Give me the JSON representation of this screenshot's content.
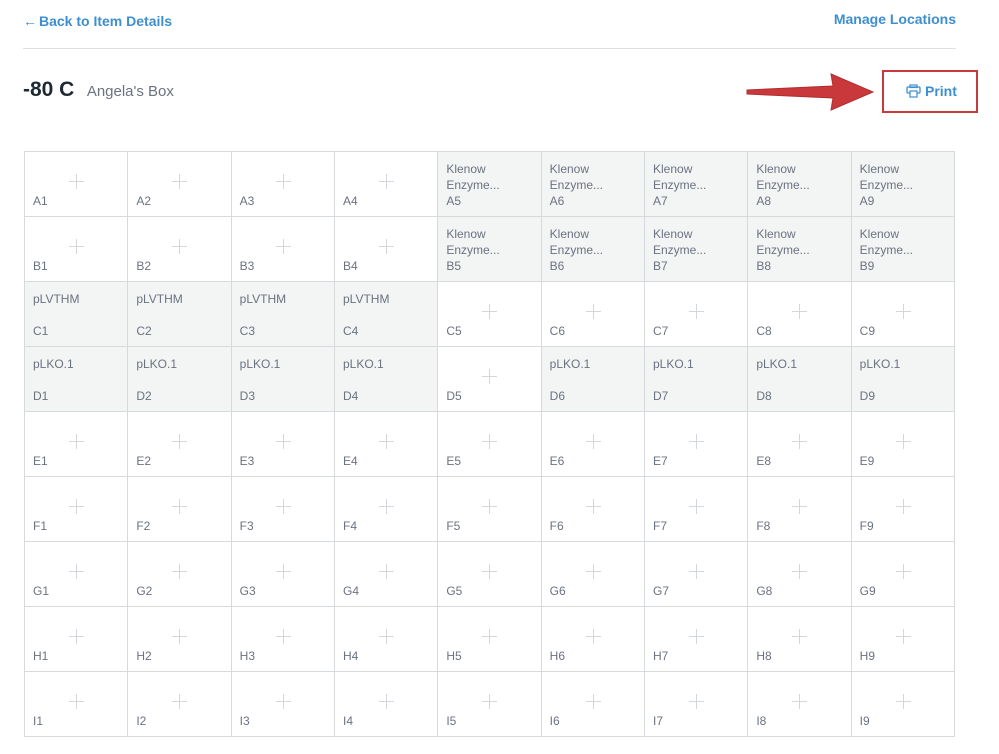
{
  "nav": {
    "back_arrow": "←",
    "back_label": "Back to Item Details",
    "manage_label": "Manage Locations"
  },
  "box": {
    "temperature": "-80 C",
    "name": "Angela's Box"
  },
  "print": {
    "label": "Print",
    "icon": "printer-icon",
    "highlight_color": "#c9383a"
  },
  "colors": {
    "link": "#3d8fd1",
    "filled_cell": "#f3f4f4",
    "annotation": "#c9383a"
  },
  "grid": {
    "rows": [
      "A",
      "B",
      "C",
      "D",
      "E",
      "F",
      "G",
      "H",
      "I"
    ],
    "columns": 9,
    "cells": [
      [
        {
          "pos": "A1",
          "item": ""
        },
        {
          "pos": "A2",
          "item": ""
        },
        {
          "pos": "A3",
          "item": ""
        },
        {
          "pos": "A4",
          "item": ""
        },
        {
          "pos": "A5",
          "item": "Klenow\nEnzyme..."
        },
        {
          "pos": "A6",
          "item": "Klenow\nEnzyme..."
        },
        {
          "pos": "A7",
          "item": "Klenow\nEnzyme..."
        },
        {
          "pos": "A8",
          "item": "Klenow\nEnzyme..."
        },
        {
          "pos": "A9",
          "item": "Klenow\nEnzyme..."
        }
      ],
      [
        {
          "pos": "B1",
          "item": ""
        },
        {
          "pos": "B2",
          "item": ""
        },
        {
          "pos": "B3",
          "item": ""
        },
        {
          "pos": "B4",
          "item": ""
        },
        {
          "pos": "B5",
          "item": "Klenow\nEnzyme..."
        },
        {
          "pos": "B6",
          "item": "Klenow\nEnzyme..."
        },
        {
          "pos": "B7",
          "item": "Klenow\nEnzyme..."
        },
        {
          "pos": "B8",
          "item": "Klenow\nEnzyme..."
        },
        {
          "pos": "B9",
          "item": "Klenow\nEnzyme..."
        }
      ],
      [
        {
          "pos": "C1",
          "item": "pLVTHM"
        },
        {
          "pos": "C2",
          "item": "pLVTHM"
        },
        {
          "pos": "C3",
          "item": "pLVTHM"
        },
        {
          "pos": "C4",
          "item": "pLVTHM"
        },
        {
          "pos": "C5",
          "item": ""
        },
        {
          "pos": "C6",
          "item": ""
        },
        {
          "pos": "C7",
          "item": ""
        },
        {
          "pos": "C8",
          "item": ""
        },
        {
          "pos": "C9",
          "item": ""
        }
      ],
      [
        {
          "pos": "D1",
          "item": "pLKO.1"
        },
        {
          "pos": "D2",
          "item": "pLKO.1"
        },
        {
          "pos": "D3",
          "item": "pLKO.1"
        },
        {
          "pos": "D4",
          "item": "pLKO.1"
        },
        {
          "pos": "D5",
          "item": ""
        },
        {
          "pos": "D6",
          "item": "pLKO.1"
        },
        {
          "pos": "D7",
          "item": "pLKO.1"
        },
        {
          "pos": "D8",
          "item": "pLKO.1"
        },
        {
          "pos": "D9",
          "item": "pLKO.1"
        }
      ],
      [
        {
          "pos": "E1",
          "item": ""
        },
        {
          "pos": "E2",
          "item": ""
        },
        {
          "pos": "E3",
          "item": ""
        },
        {
          "pos": "E4",
          "item": ""
        },
        {
          "pos": "E5",
          "item": ""
        },
        {
          "pos": "E6",
          "item": ""
        },
        {
          "pos": "E7",
          "item": ""
        },
        {
          "pos": "E8",
          "item": ""
        },
        {
          "pos": "E9",
          "item": ""
        }
      ],
      [
        {
          "pos": "F1",
          "item": ""
        },
        {
          "pos": "F2",
          "item": ""
        },
        {
          "pos": "F3",
          "item": ""
        },
        {
          "pos": "F4",
          "item": ""
        },
        {
          "pos": "F5",
          "item": ""
        },
        {
          "pos": "F6",
          "item": ""
        },
        {
          "pos": "F7",
          "item": ""
        },
        {
          "pos": "F8",
          "item": ""
        },
        {
          "pos": "F9",
          "item": ""
        }
      ],
      [
        {
          "pos": "G1",
          "item": ""
        },
        {
          "pos": "G2",
          "item": ""
        },
        {
          "pos": "G3",
          "item": ""
        },
        {
          "pos": "G4",
          "item": ""
        },
        {
          "pos": "G5",
          "item": ""
        },
        {
          "pos": "G6",
          "item": ""
        },
        {
          "pos": "G7",
          "item": ""
        },
        {
          "pos": "G8",
          "item": ""
        },
        {
          "pos": "G9",
          "item": ""
        }
      ],
      [
        {
          "pos": "H1",
          "item": ""
        },
        {
          "pos": "H2",
          "item": ""
        },
        {
          "pos": "H3",
          "item": ""
        },
        {
          "pos": "H4",
          "item": ""
        },
        {
          "pos": "H5",
          "item": ""
        },
        {
          "pos": "H6",
          "item": ""
        },
        {
          "pos": "H7",
          "item": ""
        },
        {
          "pos": "H8",
          "item": ""
        },
        {
          "pos": "H9",
          "item": ""
        }
      ],
      [
        {
          "pos": "I1",
          "item": ""
        },
        {
          "pos": "I2",
          "item": ""
        },
        {
          "pos": "I3",
          "item": ""
        },
        {
          "pos": "I4",
          "item": ""
        },
        {
          "pos": "I5",
          "item": ""
        },
        {
          "pos": "I6",
          "item": ""
        },
        {
          "pos": "I7",
          "item": ""
        },
        {
          "pos": "I8",
          "item": ""
        },
        {
          "pos": "I9",
          "item": ""
        }
      ]
    ]
  }
}
